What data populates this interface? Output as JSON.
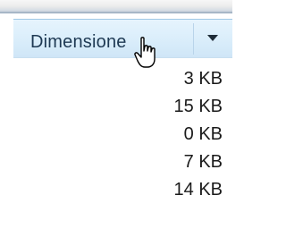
{
  "column_header": {
    "label": "Dimensione",
    "dropdown_icon": "triangle-down-icon"
  },
  "sizes": [
    "3 KB",
    "15 KB",
    "0 KB",
    "7 KB",
    "14 KB"
  ],
  "cursor_icon": "hand-pointer-cursor-icon",
  "colors": {
    "header_bg": "#d9eefb",
    "header_border": "#9fc8e6",
    "header_text": "#1e3953",
    "text": "#1a1a1a"
  }
}
